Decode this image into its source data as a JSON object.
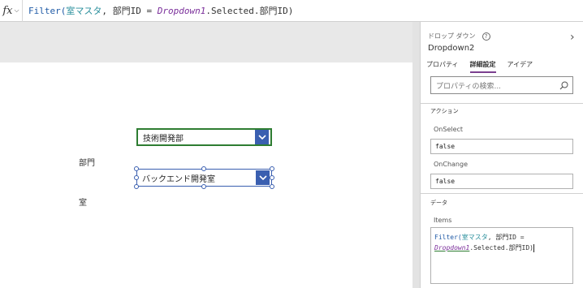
{
  "formula_bar": {
    "fx_label": "fx",
    "expr": {
      "fn": "Filter(",
      "table": "室マスタ",
      "mid": ", 部門ID = ",
      "var": "Dropdown1",
      "tail": ".Selected.部門ID)"
    }
  },
  "canvas": {
    "dept_label": "部門",
    "dept_value": "技術開発部",
    "room_label": "室",
    "room_value": "バックエンド開発室"
  },
  "panel": {
    "control_type": "ドロップ ダウン",
    "control_name": "Dropdown2",
    "tabs": [
      {
        "label": "プロパティ",
        "active": false
      },
      {
        "label": "詳細設定",
        "active": true
      },
      {
        "label": "アイデア",
        "active": false
      }
    ],
    "search_placeholder": "プロパティの検索...",
    "section_action": "アクション",
    "onselect_label": "OnSelect",
    "onselect_value": "false",
    "onchange_label": "OnChange",
    "onchange_value": "false",
    "section_data": "データ",
    "items_label": "Items",
    "items_formula": {
      "fn": "Filter(",
      "table": "室マスタ",
      "mid": ", 部門ID =",
      "var": "Dropdown1",
      "tail": ".Selected.部門ID)"
    }
  },
  "colors": {
    "accent": "#3a5fb0",
    "selected_border": "#2e7d32",
    "tab_underline": "#7b3f8f"
  }
}
